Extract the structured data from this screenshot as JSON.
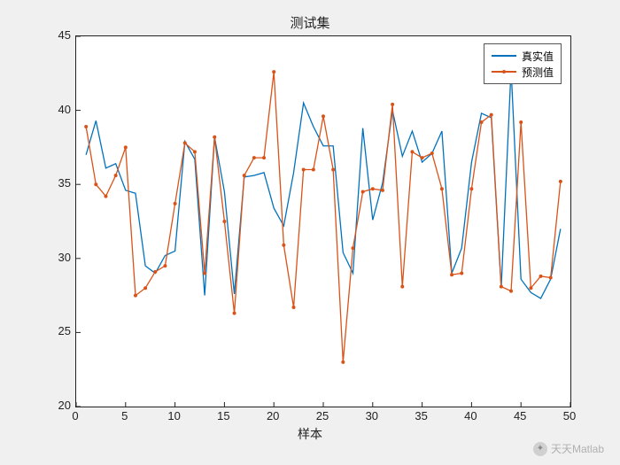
{
  "chart_data": {
    "type": "line",
    "title": "测试集",
    "xlabel": "样本",
    "ylabel": "",
    "xlim": [
      0,
      50
    ],
    "ylim": [
      20,
      45
    ],
    "xticks": [
      0,
      5,
      10,
      15,
      20,
      25,
      30,
      35,
      40,
      45,
      50
    ],
    "yticks": [
      20,
      25,
      30,
      35,
      40,
      45
    ],
    "x": [
      1,
      2,
      3,
      4,
      5,
      6,
      7,
      8,
      9,
      10,
      11,
      12,
      13,
      14,
      15,
      16,
      17,
      18,
      19,
      20,
      21,
      22,
      23,
      24,
      25,
      26,
      27,
      28,
      29,
      30,
      31,
      32,
      33,
      34,
      35,
      36,
      37,
      38,
      39,
      40,
      41,
      42,
      43,
      44,
      45,
      46,
      47,
      48,
      49
    ],
    "series": [
      {
        "name": "真实值",
        "color": "#0072BD",
        "marker": false,
        "values": [
          37.0,
          39.3,
          36.1,
          36.4,
          34.6,
          34.4,
          29.5,
          29.0,
          30.2,
          30.5,
          37.9,
          36.7,
          27.5,
          38.2,
          34.5,
          27.6,
          35.5,
          35.6,
          35.8,
          33.4,
          32.2,
          35.8,
          40.5,
          38.9,
          37.6,
          37.6,
          30.4,
          29.0,
          38.8,
          32.6,
          35.1,
          40.0,
          36.9,
          38.6,
          36.5,
          37.1,
          38.6,
          29.0,
          30.7,
          36.5,
          39.8,
          39.5,
          28.0,
          42.8,
          28.6,
          27.7,
          27.3,
          28.6,
          32.0
        ]
      },
      {
        "name": "预测值",
        "color": "#D95319",
        "marker": true,
        "values": [
          38.9,
          35.0,
          34.2,
          35.6,
          37.5,
          27.5,
          28.0,
          29.1,
          29.5,
          33.7,
          37.8,
          37.2,
          29.0,
          38.2,
          32.5,
          26.3,
          35.6,
          36.8,
          36.8,
          42.6,
          30.9,
          26.7,
          36.0,
          36.0,
          39.6,
          36.0,
          23.0,
          30.7,
          34.5,
          34.7,
          34.6,
          40.4,
          28.1,
          37.2,
          36.8,
          37.1,
          34.7,
          28.9,
          29.0,
          34.7,
          39.2,
          39.7,
          28.1,
          27.8,
          39.2,
          28.0,
          28.8,
          28.7,
          35.2
        ]
      }
    ],
    "legend_position": "top-right"
  },
  "watermark": "天天Matlab"
}
